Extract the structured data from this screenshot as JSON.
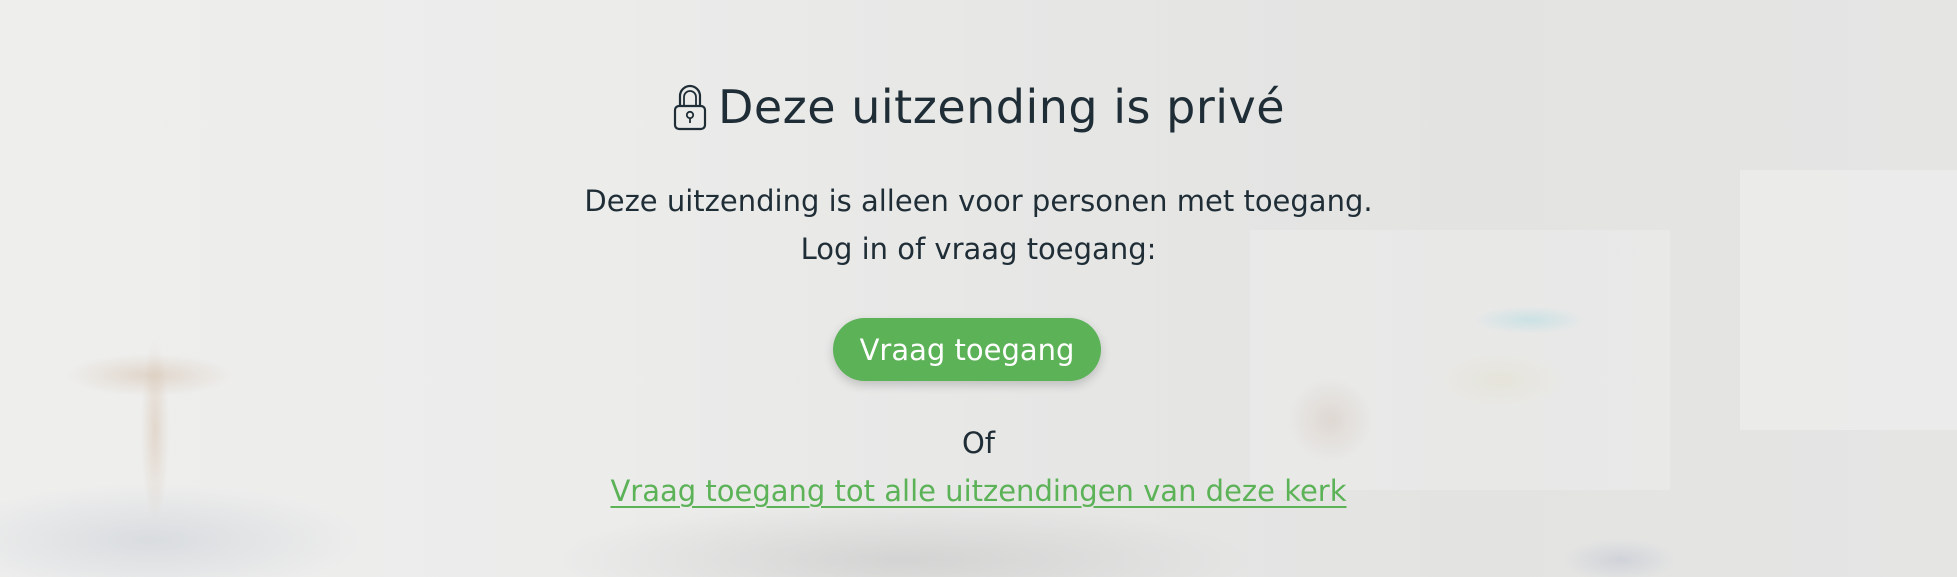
{
  "page": {
    "title": "Deze uitzending is privé",
    "description_line1": "Deze uitzending is alleen voor personen met toegang.",
    "description_line2": "Log in of vraag toegang:",
    "request_access_button": "Vraag toegang",
    "or_label": "Of",
    "request_all_link": "Vraag toegang tot alle uitzendingen van deze kerk"
  },
  "icons": {
    "title_icon": "lock-icon"
  },
  "colors": {
    "accent": "#5cb257",
    "text": "#1f2d36",
    "button_text": "#ffffff"
  }
}
